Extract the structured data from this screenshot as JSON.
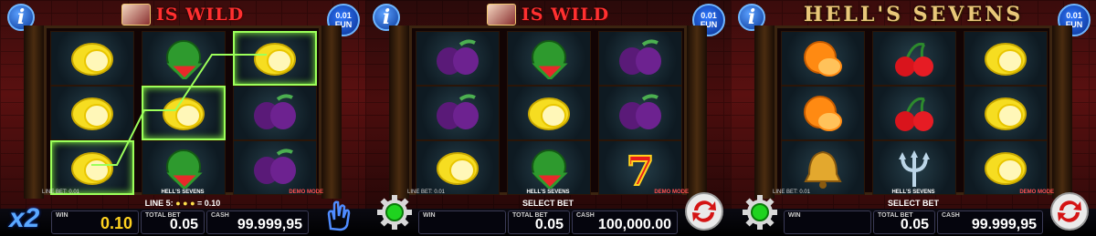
{
  "panels": [
    {
      "title": "IS WILD",
      "fun": {
        "amount": "0.01",
        "currency": "FUN"
      },
      "meta": {
        "line_bet": "LINE BET: 0.01",
        "game_name": "HELL'S SEVENS",
        "mode": "DEMO MODE"
      },
      "status": {
        "line_label": "LINE 5:",
        "line_win": "= 0.10"
      },
      "win": {
        "label": "WIN",
        "value": "0.10"
      },
      "total_bet": {
        "label": "TOTAL BET",
        "value": "0.05"
      },
      "cash": {
        "label": "CASH",
        "value": "99.999,95"
      },
      "multiplier": "x2",
      "reels": [
        [
          "lemon",
          "lemon",
          "lemon"
        ],
        [
          "watermelon",
          "lemon",
          "watermelon"
        ],
        [
          "lemon",
          "plum",
          "plum"
        ]
      ],
      "wins": [
        [
          0,
          2
        ],
        [
          1,
          1
        ],
        [
          2,
          0
        ]
      ]
    },
    {
      "title": "IS WILD",
      "fun": {
        "amount": "0.01",
        "currency": "FUN"
      },
      "meta": {
        "line_bet": "LINE BET: 0.01",
        "game_name": "HELL'S SEVENS",
        "mode": "DEMO MODE"
      },
      "status": {
        "label": "SELECT BET"
      },
      "win": {
        "label": "WIN",
        "value": ""
      },
      "total_bet": {
        "label": "TOTAL BET",
        "value": "0.05"
      },
      "cash": {
        "label": "CASH",
        "value": "100,000.00"
      },
      "reels": [
        [
          "plum",
          "plum",
          "lemon"
        ],
        [
          "watermelon",
          "lemon",
          "watermelon"
        ],
        [
          "plum",
          "plum",
          "seven"
        ]
      ]
    },
    {
      "title": "HELL'S SEVENS",
      "fun": {
        "amount": "0.01",
        "currency": "FUN"
      },
      "meta": {
        "line_bet": "LINE BET: 0.01",
        "game_name": "HELL'S SEVENS",
        "mode": "DEMO MODE"
      },
      "status": {
        "label": "SELECT BET"
      },
      "win": {
        "label": "WIN",
        "value": ""
      },
      "total_bet": {
        "label": "TOTAL BET",
        "value": "0.05"
      },
      "cash": {
        "label": "CASH",
        "value": "99.999,95"
      },
      "reels": [
        [
          "orange",
          "orange",
          "bell"
        ],
        [
          "cherry",
          "cherry",
          "trident"
        ],
        [
          "lemon",
          "lemon",
          "lemon"
        ]
      ]
    }
  ],
  "colors": {
    "win_highlight": "#9cff5a",
    "win_value": "#ffd21f",
    "title_red": "#ff3030",
    "title_gold": "#e9c77a"
  }
}
